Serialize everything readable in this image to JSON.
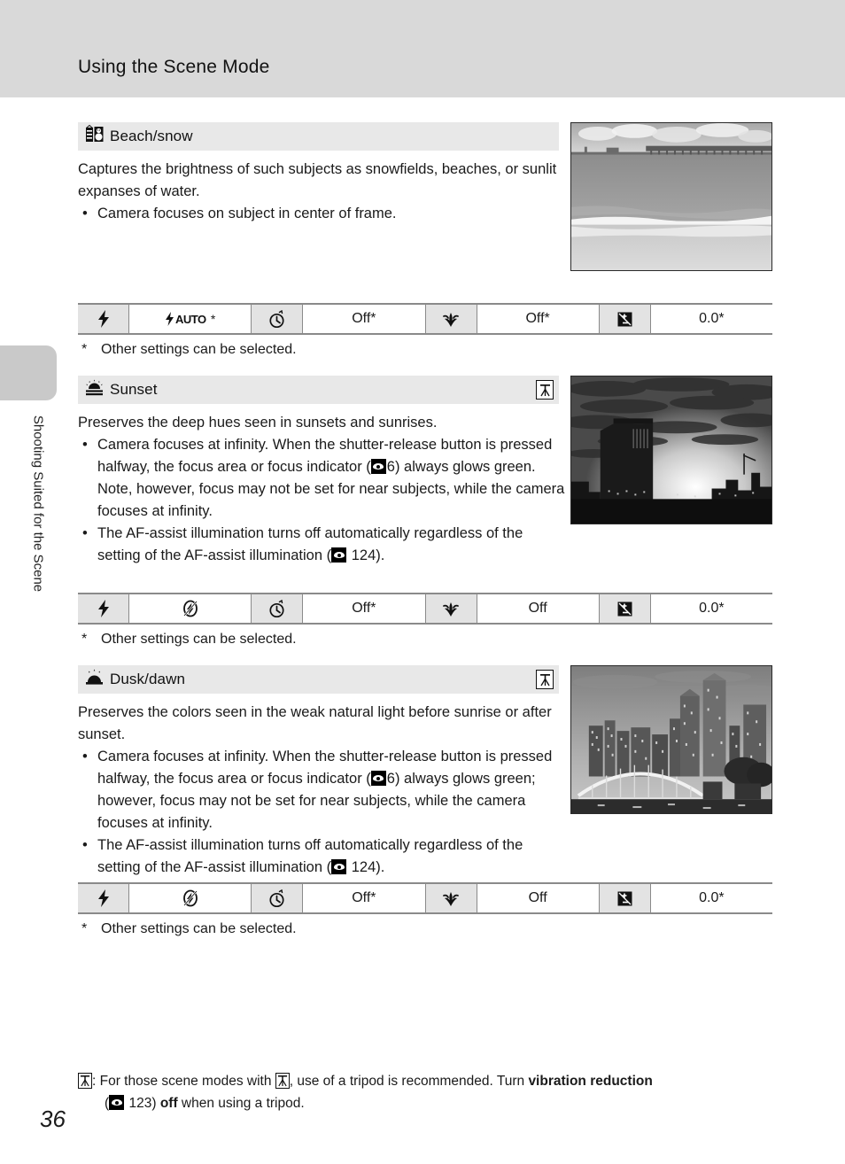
{
  "header": {
    "title": "Using the Scene Mode"
  },
  "side_tab": {
    "label": "Shooting Suited for the Scene"
  },
  "page_number": "36",
  "sections": [
    {
      "icon_name": "beach-snow-icon",
      "title": "Beach/snow",
      "has_tripod_badge": false,
      "intro": "Captures the brightness of such subjects as snowfields, beaches, or sunlit expanses of water.",
      "bullets": [
        {
          "text_before": "Camera focuses on subject in center of frame.",
          "ref": null,
          "text_after": ""
        }
      ],
      "photo_name": "beach-pier-photo",
      "settings": {
        "flash_icon": "flash-icon",
        "flash_value": "AUTO*",
        "flash_value_is_glyph": true,
        "timer_icon": "self-timer-icon",
        "timer_value": "Off*",
        "macro_icon": "macro-flower-icon",
        "macro_value": "Off*",
        "ev_icon": "exposure-compensation-icon",
        "ev_value": "0.0*"
      },
      "note": "Other settings can be selected."
    },
    {
      "icon_name": "sunset-icon",
      "title": "Sunset",
      "has_tripod_badge": true,
      "intro": "Preserves the deep hues seen in sunsets and sunrises.",
      "bullets": [
        {
          "text_before": "Camera focuses at infinity. When the shutter-release button is pressed halfway, the focus area or focus indicator (",
          "ref": "6",
          "text_after": ") always glows green. Note, however, focus may not be set for near subjects, while the camera focuses at infinity."
        },
        {
          "text_before": "The AF-assist illumination turns off automatically regardless of the setting of the AF-assist illumination (",
          "ref": "124",
          "text_after": ")."
        }
      ],
      "photo_name": "sunset-city-photo",
      "settings": {
        "flash_icon": "flash-icon",
        "flash_value": "flash-off-icon",
        "flash_value_is_glyph": true,
        "timer_icon": "self-timer-icon",
        "timer_value": "Off*",
        "macro_icon": "macro-flower-icon",
        "macro_value": "Off",
        "ev_icon": "exposure-compensation-icon",
        "ev_value": "0.0*"
      },
      "note": "Other settings can be selected."
    },
    {
      "icon_name": "dusk-dawn-icon",
      "title": "Dusk/dawn",
      "has_tripod_badge": true,
      "intro": "Preserves the colors seen in the weak natural light before sunrise or after sunset.",
      "bullets": [
        {
          "text_before": "Camera focuses at infinity. When the shutter-release button is pressed halfway, the focus area or focus indicator (",
          "ref": "6",
          "text_after": ") always glows green; however, focus may not be set for near subjects, while the camera focuses at infinity."
        },
        {
          "text_before": "The AF-assist illumination turns off automatically regardless of the setting of the AF-assist illumination (",
          "ref": "124",
          "text_after": ")."
        }
      ],
      "photo_name": "dusk-bridge-photo",
      "settings": {
        "flash_icon": "flash-icon",
        "flash_value": "flash-off-icon",
        "flash_value_is_glyph": true,
        "timer_icon": "self-timer-icon",
        "timer_value": "Off*",
        "macro_icon": "macro-flower-icon",
        "macro_value": "Off",
        "ev_icon": "exposure-compensation-icon",
        "ev_value": "0.0*"
      },
      "note": "Other settings can be selected."
    }
  ],
  "footnote": {
    "part1": ": For those scene modes with ",
    "part2": ", use of a tripod is recommended. Turn ",
    "bold1": "vibration reduction",
    "part3": " (",
    "ref": "123",
    "part4": ") ",
    "bold2": "off",
    "part5": " when using a tripod."
  },
  "colors": {
    "header_band": "#d9d9d9",
    "section_head": "#e8e8e8",
    "cell_icon_bg": "#e3e3e3",
    "rule": "#8a8a8a"
  }
}
